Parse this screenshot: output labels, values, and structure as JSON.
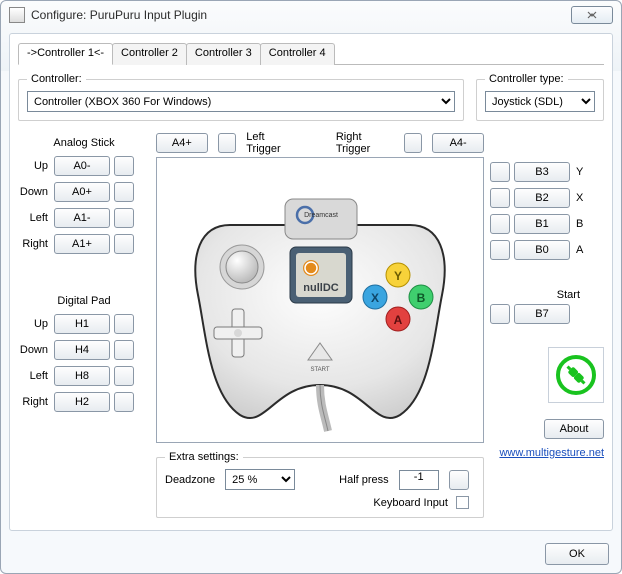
{
  "window": {
    "title": "Configure: PuruPuru Input Plugin"
  },
  "tabs": [
    "->Controller 1<-",
    "Controller 2",
    "Controller 3",
    "Controller 4"
  ],
  "controller": {
    "label": "Controller:",
    "value": "Controller (XBOX 360 For Windows)"
  },
  "controller_type": {
    "label": "Controller type:",
    "value": "Joystick (SDL)"
  },
  "triggers": {
    "left_btn": "A4+",
    "left_label": "Left Trigger",
    "right_label": "Right Trigger",
    "right_btn": "A4-"
  },
  "analog": {
    "heading": "Analog Stick",
    "up": {
      "label": "Up",
      "value": "A0-"
    },
    "down": {
      "label": "Down",
      "value": "A0+"
    },
    "left": {
      "label": "Left",
      "value": "A1-"
    },
    "right": {
      "label": "Right",
      "value": "A1+"
    }
  },
  "digital": {
    "heading": "Digital Pad",
    "up": {
      "label": "Up",
      "value": "H1"
    },
    "down": {
      "label": "Down",
      "value": "H4"
    },
    "left": {
      "label": "Left",
      "value": "H8"
    },
    "right": {
      "label": "Right",
      "value": "H2"
    }
  },
  "face": {
    "y": {
      "value": "B3",
      "label": "Y"
    },
    "x": {
      "value": "B2",
      "label": "X"
    },
    "b": {
      "value": "B1",
      "label": "B"
    },
    "a": {
      "value": "B0",
      "label": "A"
    }
  },
  "start": {
    "heading": "Start",
    "value": "B7"
  },
  "extra": {
    "legend": "Extra settings:",
    "deadzone_label": "Deadzone",
    "deadzone_value": "25 %",
    "halfpress_label": "Half press",
    "halfpress_value": "-1",
    "keyboard_label": "Keyboard Input"
  },
  "about_label": "About",
  "link": "www.multigesture.net",
  "ok_label": "OK",
  "controller_image": {
    "brand": "Dreamcast",
    "screen_text": "nullDC"
  }
}
